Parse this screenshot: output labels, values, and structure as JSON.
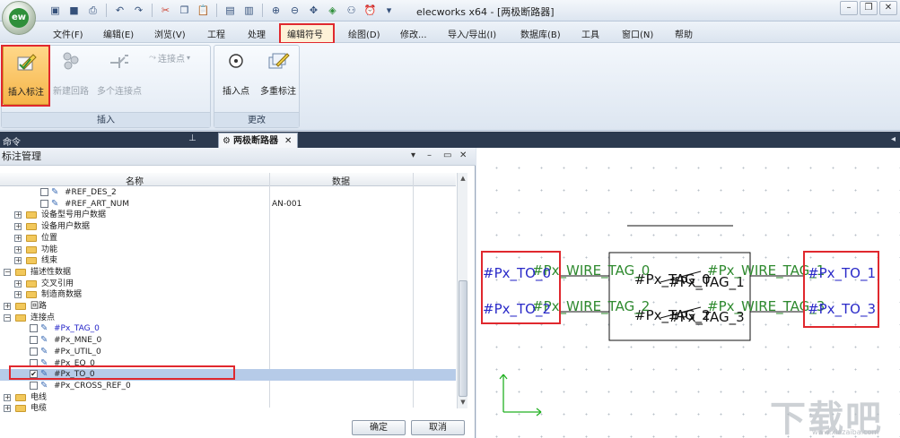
{
  "app": {
    "logo_text": "ew",
    "window_title": "elecworks x64 - [两极断路器]",
    "qat_icons": [
      "new-file-icon",
      "save-icon",
      "print-icon",
      "undo-icon",
      "redo-icon",
      "cut-icon",
      "copy-icon",
      "paste-icon",
      "page-icon",
      "page2-icon",
      "zoom-in-icon",
      "zoom-out-icon",
      "pan-icon",
      "zoom-fit-icon",
      "binoculars-icon",
      "clock-icon"
    ]
  },
  "menu": {
    "items": [
      "文件(F)",
      "编辑(E)",
      "浏览(V)",
      "工程",
      "处理",
      "编辑符号",
      "绘图(D)",
      "修改...",
      "导入/导出(I)",
      "数据库(B)",
      "工具",
      "窗口(N)",
      "帮助"
    ],
    "active": "编辑符号"
  },
  "ribbon": {
    "group_insert": {
      "label": "插入",
      "buttons": {
        "insert_tag": "插入标注",
        "new_circuit": "新建回路",
        "multi_connect": "多个连接点",
        "connect_point": "连接点"
      }
    },
    "group_change": {
      "label": "更改",
      "buttons": {
        "insert_point": "插入点",
        "multi_tag": "多重标注"
      }
    }
  },
  "docbar": {
    "command_label": "命令",
    "doc_tab": "两极断路器"
  },
  "tag_manager": {
    "title": "标注管理",
    "col_name": "名称",
    "col_data": "数据",
    "rows": [
      {
        "level": 3,
        "type": "leaf",
        "checked": false,
        "label": "#REF_DES_2",
        "value": ""
      },
      {
        "level": 3,
        "type": "leaf",
        "checked": false,
        "label": "#REF_ART_NUM",
        "value": "AN-001"
      },
      {
        "level": 1,
        "type": "folder",
        "label": "设备型号用户数据"
      },
      {
        "level": 1,
        "type": "folder",
        "label": "设备用户数据"
      },
      {
        "level": 1,
        "type": "folder",
        "label": "位置"
      },
      {
        "level": 1,
        "type": "folder",
        "label": "功能"
      },
      {
        "level": 1,
        "type": "folder",
        "label": "线束"
      },
      {
        "level": 0,
        "type": "folder",
        "open": true,
        "label": "描述性数据"
      },
      {
        "level": 1,
        "type": "folder",
        "label": "交叉引用"
      },
      {
        "level": 1,
        "type": "folder",
        "label": "制造商数据"
      },
      {
        "level": 0,
        "type": "folder",
        "label": "回路"
      },
      {
        "level": 0,
        "type": "folder",
        "open": true,
        "label": "连接点"
      },
      {
        "level": 2,
        "type": "leaf",
        "checked": false,
        "blue": true,
        "label": "#Px_TAG_0",
        "value": ""
      },
      {
        "level": 2,
        "type": "leaf",
        "checked": false,
        "label": "#Px_MNE_0",
        "value": ""
      },
      {
        "level": 2,
        "type": "leaf",
        "checked": false,
        "label": "#Px_UTIL_0",
        "value": ""
      },
      {
        "level": 2,
        "type": "leaf",
        "checked": false,
        "label": "#Px_EQ_0",
        "value": ""
      },
      {
        "level": 2,
        "type": "leaf",
        "checked": true,
        "selected": true,
        "label": "#Px_TO_0",
        "value": ""
      },
      {
        "level": 2,
        "type": "leaf",
        "checked": false,
        "label": "#Px_CROSS_REF_0",
        "value": ""
      },
      {
        "level": 0,
        "type": "folder",
        "label": "电线"
      },
      {
        "level": 0,
        "type": "folder",
        "label": "电缆"
      }
    ],
    "ok_label": "确定",
    "cancel_label": "取消"
  },
  "canvas": {
    "labels": {
      "to0": "#Px_TO_0",
      "to2": "#Px_TO_2",
      "to1": "#Px_TO_1",
      "to3": "#Px_TO_3",
      "wire0": "#Px_WIRE_TAG_0",
      "wire2": "#Px_WIRE_TAG_2",
      "wire1": "#Px_WIRE_TAG_1",
      "wire3": "#Px_WIRE_TAG_3",
      "tag1": "#Px_TAG_1",
      "tag3": "#Px_TAG_3",
      "tag0": "#Px_TAG_0",
      "tag2": "#Px_TAG_2"
    }
  },
  "watermark": {
    "text": "下载吧",
    "sub": "www.xiazaiba.com"
  }
}
